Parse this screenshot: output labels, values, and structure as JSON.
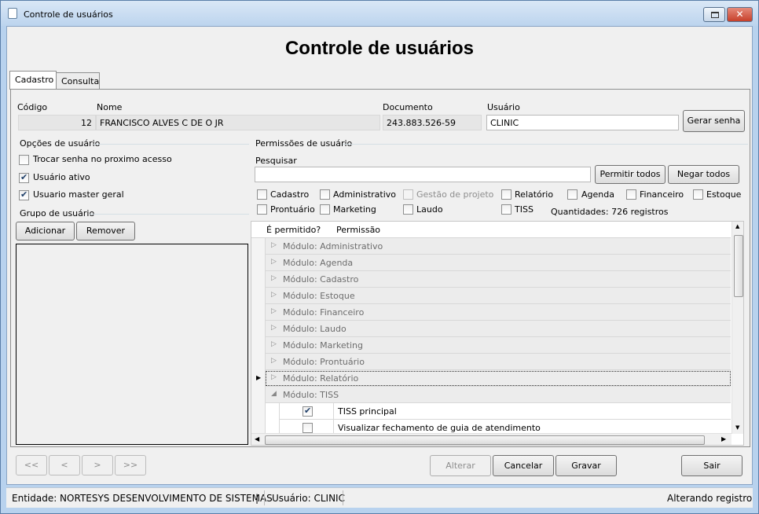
{
  "window": {
    "title": "Controle de usuários"
  },
  "header": {
    "title": "Controle de usuários"
  },
  "tabs": [
    {
      "label": "Cadastro"
    },
    {
      "label": "Consulta"
    }
  ],
  "form": {
    "codigo_label": "Código",
    "codigo_value": "12",
    "nome_label": "Nome",
    "nome_value": "FRANCISCO ALVES C DE O JR",
    "documento_label": "Documento",
    "documento_value": "243.883.526-59",
    "usuario_label": "Usuário",
    "usuario_value": "CLINIC",
    "gerar_senha_label": "Gerar senha"
  },
  "user_options": {
    "title": "Opções de usuário",
    "items": [
      {
        "label": "Trocar senha no proximo acesso",
        "checked": false
      },
      {
        "label": "Usuário ativo",
        "checked": true
      },
      {
        "label": "Usuario master geral",
        "checked": true
      }
    ]
  },
  "user_group": {
    "title": "Grupo de usuário",
    "add_label": "Adicionar",
    "remove_label": "Remover"
  },
  "permissions": {
    "title": "Permissões de usuário",
    "search_label": "Pesquisar",
    "search_value": "",
    "allow_all_label": "Permitir todos",
    "deny_all_label": "Negar todos",
    "filters": [
      {
        "label": "Cadastro",
        "checked": false,
        "disabled": false
      },
      {
        "label": "Administrativo",
        "checked": false,
        "disabled": false
      },
      {
        "label": "Gestão de projeto",
        "checked": false,
        "disabled": true
      },
      {
        "label": "Relatório",
        "checked": false,
        "disabled": false
      },
      {
        "label": "Agenda",
        "checked": false,
        "disabled": false
      },
      {
        "label": "Financeiro",
        "checked": false,
        "disabled": false
      },
      {
        "label": "Estoque",
        "checked": false,
        "disabled": false
      },
      {
        "label": "Prontuário",
        "checked": false,
        "disabled": false
      },
      {
        "label": "Marketing",
        "checked": false,
        "disabled": false
      },
      {
        "label": "Laudo",
        "checked": false,
        "disabled": false
      },
      {
        "label": "TISS",
        "checked": false,
        "disabled": false
      }
    ],
    "count_text": "Quantidades: 726 registros",
    "columns": {
      "allowed": "É permitido?",
      "permission": "Permissão"
    },
    "groups": [
      "Módulo: Administrativo",
      "Módulo: Agenda",
      "Módulo: Cadastro",
      "Módulo: Estoque",
      "Módulo: Financeiro",
      "Módulo: Laudo",
      "Módulo: Marketing",
      "Módulo: Prontuário",
      "Módulo: Relatório",
      "Módulo: TISS"
    ],
    "tiss_rows": [
      {
        "label": "TISS principal",
        "checked": true
      },
      {
        "label": "Visualizar fechamento de guia de atendimento",
        "checked": false
      }
    ]
  },
  "nav": {
    "first": "<<",
    "prev": "<",
    "next": ">",
    "last": ">>"
  },
  "actions": {
    "alterar": "Alterar",
    "cancelar": "Cancelar",
    "gravar": "Gravar",
    "sair": "Sair"
  },
  "status": {
    "entidade": "Entidade: NORTESYS DESENVOLVIMENTO DE SISTEMAS",
    "sep": "|",
    "usuario": "Usuário: CLINIC",
    "mode": "Alterando registro"
  }
}
